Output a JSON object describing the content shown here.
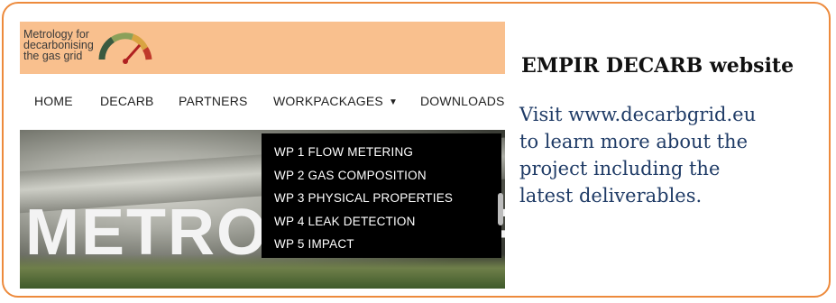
{
  "logo": {
    "line1": "Metrology for",
    "line2": "decarbonising",
    "line3": "the gas grid",
    "icon": "gauge-icon"
  },
  "nav": {
    "items": [
      "HOME",
      "DECARB",
      "PARTNERS",
      "WORKPACKAGES",
      "DOWNLOADS"
    ],
    "caret_icon": "caret-down-icon"
  },
  "dropdown": {
    "items": [
      "WP 1 FLOW METERING",
      "WP 2 GAS COMPOSITION",
      "WP 3 PHYSICAL PROPERTIES",
      "WP 4 LEAK DETECTION",
      "WP 5 IMPACT"
    ]
  },
  "hero": {
    "title": "METROLOGY FOR"
  },
  "side": {
    "title": "EMPIR DECARB website",
    "body_lines": [
      "Visit www.decarbgrid.eu",
      "to learn more about the",
      "project including the",
      "latest deliverables."
    ]
  },
  "colors": {
    "border": "#ED8A3C",
    "header_band": "#F9C08E",
    "body_text": "#1F3B66",
    "dropdown_bg": "#000000"
  }
}
